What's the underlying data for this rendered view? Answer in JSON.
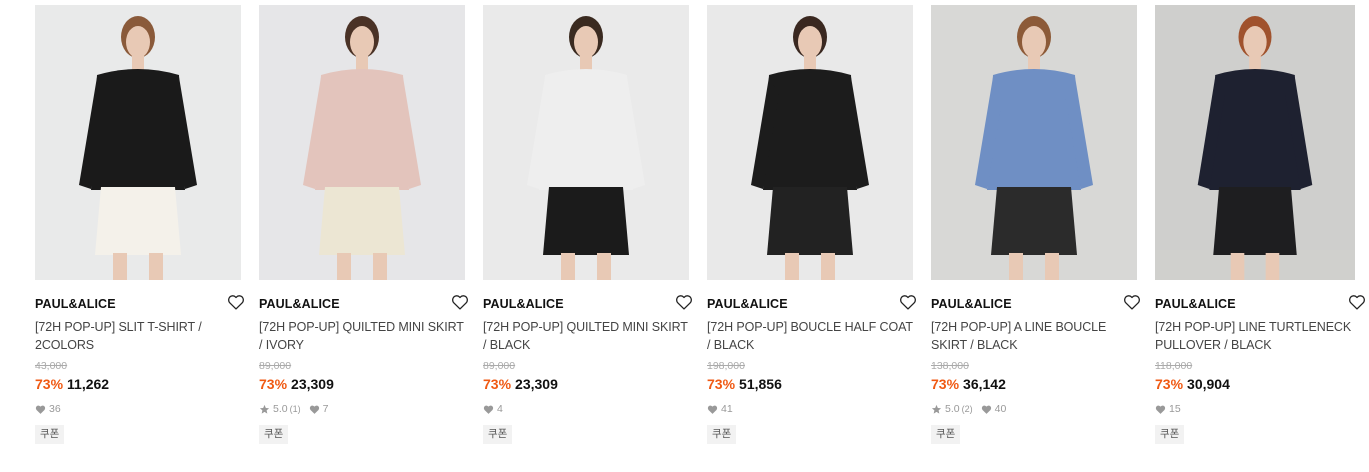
{
  "products": [
    {
      "brand": "PAUL&ALICE",
      "name": "[72H POP-UP] SLIT T-SHIRT / 2COLORS",
      "original_price": "43,000",
      "discount": "73%",
      "price": "11,262",
      "likes": "36",
      "coupon": "쿠폰",
      "bg": "#e9eaea",
      "outfit": "#1a1a1a"
    },
    {
      "brand": "PAUL&ALICE",
      "name": "[72H POP-UP] QUILTED MINI SKIRT / IVORY",
      "original_price": "89,000",
      "discount": "73%",
      "price": "23,309",
      "rating": "5.0",
      "reviews": "(1)",
      "likes": "7",
      "coupon": "쿠폰",
      "bg": "#e6e6e8",
      "outfit": "#e3c4bc"
    },
    {
      "brand": "PAUL&ALICE",
      "name": "[72H POP-UP] QUILTED MINI SKIRT / BLACK",
      "original_price": "89,000",
      "discount": "73%",
      "price": "23,309",
      "likes": "4",
      "coupon": "쿠폰",
      "bg": "#eaeaea",
      "outfit": "#eeeeee"
    },
    {
      "brand": "PAUL&ALICE",
      "name": "[72H POP-UP] BOUCLE HALF COAT / BLACK",
      "original_price": "198,000",
      "discount": "73%",
      "price": "51,856",
      "likes": "41",
      "coupon": "쿠폰",
      "bg": "#e9e9e9",
      "outfit": "#1c1c1c"
    },
    {
      "brand": "PAUL&ALICE",
      "name": "[72H POP-UP] A LINE BOUCLE SKIRT / BLACK",
      "original_price": "138,000",
      "discount": "73%",
      "price": "36,142",
      "rating": "5.0",
      "reviews": "(2)",
      "likes": "40",
      "coupon": "쿠폰",
      "bg": "#d8d8d6",
      "outfit": "#6f8fc4"
    },
    {
      "brand": "PAUL&ALICE",
      "name": "[72H POP-UP] LINE TURTLENECK PULLOVER / BLACK",
      "original_price": "118,000",
      "discount": "73%",
      "price": "30,904",
      "likes": "15",
      "coupon": "쿠폰",
      "bg": "#cfcfcd",
      "outfit": "#1e2130"
    }
  ],
  "colors": {
    "discount": "#f05a14",
    "text": "#111111",
    "muted": "#999999",
    "strike": "#aaaaaa",
    "coupon_bg": "#f2f2f2"
  },
  "icons": {
    "wishlist": "heart-outline-icon",
    "likes": "heart-filled-icon",
    "rating": "star-icon"
  }
}
